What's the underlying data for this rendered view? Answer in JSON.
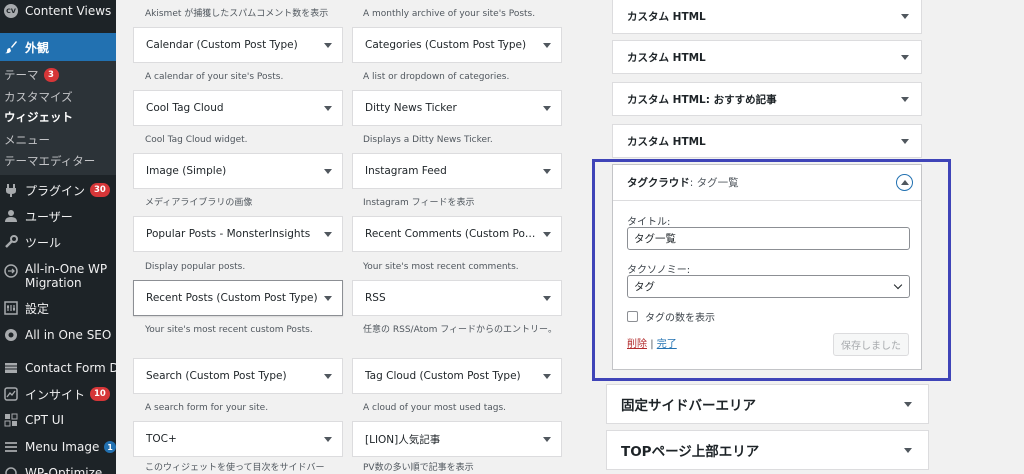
{
  "admin_menu": {
    "content_views": "Content Views",
    "appearance": "外観",
    "submenu": {
      "theme": "テーマ",
      "theme_badge": "3",
      "customize": "カスタマイズ",
      "widgets": "ウィジェット",
      "menus": "メニュー",
      "theme_editor": "テーマエディター"
    },
    "plugins": "プラグイン",
    "plugins_badge": "30",
    "users": "ユーザー",
    "tools": "ツール",
    "migration_line1": "All-in-One WP",
    "migration_line2": "Migration",
    "settings": "設定",
    "seo": "All in One SEO",
    "contact_db": "Contact Form DB",
    "insights": "インサイト",
    "insights_badge": "10",
    "cpt_ui": "CPT UI",
    "menu_image": "Menu Image",
    "menu_image_badge": "1",
    "wp_optimize": "WP-Optimize"
  },
  "available_widgets": {
    "top_desc_left": "Akismet が捕獲したスパムコメント数を表示",
    "top_desc_right": "A monthly archive of your site's Posts.",
    "rows": [
      {
        "left": {
          "title": "Calendar (Custom Post Type)",
          "desc": "A calendar of your site's Posts."
        },
        "right": {
          "title": "Categories (Custom Post Type)",
          "desc": "A list or dropdown of categories."
        }
      },
      {
        "left": {
          "title": "Cool Tag Cloud",
          "desc": "Cool Tag Cloud widget."
        },
        "right": {
          "title": "Ditty News Ticker",
          "desc": "Displays a Ditty News Ticker."
        }
      },
      {
        "left": {
          "title": "Image (Simple)",
          "desc": "メディアライブラリの画像"
        },
        "right": {
          "title": "Instagram Feed",
          "desc": "Instagram フィードを表示"
        }
      },
      {
        "left": {
          "title": "Popular Posts - MonsterInsights",
          "desc": "Display popular posts."
        },
        "right": {
          "title": "Recent Comments (Custom Post...",
          "desc": "Your site's most recent comments."
        }
      },
      {
        "left": {
          "title": "Recent Posts (Custom Post Type)",
          "desc": "Your site's most recent custom Posts."
        },
        "right": {
          "title": "RSS",
          "desc": "任意の RSS/Atom フィードからのエントリー。"
        }
      },
      {
        "left": {
          "title": "Search (Custom Post Type)",
          "desc": "A search form for your site."
        },
        "right": {
          "title": "Tag Cloud (Custom Post Type)",
          "desc": "A cloud of your most used tags."
        }
      },
      {
        "left": {
          "title": "TOC+",
          "desc": "このウィジェットを使って目次をサイドバー"
        },
        "right": {
          "title": "[LION]人気記事",
          "desc": "PV数の多い順で記事を表示"
        }
      }
    ]
  },
  "sidebar_area": {
    "widgets": [
      {
        "title": "カスタム HTML",
        "subtitle": ""
      },
      {
        "title": "カスタム HTML",
        "subtitle": ""
      },
      {
        "title": "カスタム HTML",
        "subtitle": ": おすすめ記事"
      },
      {
        "title": "カスタム HTML",
        "subtitle": ""
      }
    ],
    "expanded": {
      "title": "タグクラウド",
      "subtitle": ": タグ一覧",
      "title_label": "タイトル:",
      "title_value": "タグ一覧",
      "taxonomy_label": "タクソノミー:",
      "taxonomy_value": "タグ",
      "show_count_label": "タグの数を表示",
      "delete_link": "削除",
      "separator": "|",
      "done_link": "完了",
      "save_button": "保存しました"
    }
  },
  "widget_areas": [
    {
      "title": "固定サイドバーエリア"
    },
    {
      "title": "TOPページ上部エリア"
    }
  ],
  "colors": {
    "accent": "#2271b1",
    "sidebar_bg": "#1d2327",
    "highlight_frame": "#3f44b8",
    "badge_red": "#d63638"
  }
}
